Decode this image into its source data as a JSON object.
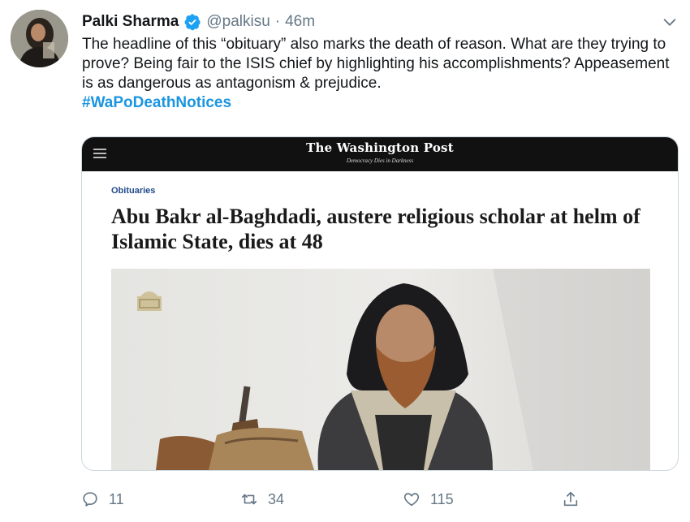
{
  "tweet": {
    "author_name": "Palki Sharma",
    "handle": "@palkisu",
    "separator": "·",
    "time": "46m",
    "text": "The headline of this “obituary” also marks the death of reason. What are they trying to prove? Being fair to the ISIS chief by highlighting his accomplishments? Appeasement is as dangerous as antagonism & prejudice.",
    "hashtag": "#WaPoDeathNotices",
    "icons": {
      "verified": "verified-badge-icon",
      "more": "chevron-down-icon"
    },
    "accent_color": "#1b95e0"
  },
  "card": {
    "masthead": "The Washington Post",
    "tagline": "Democracy Dies in Darkness",
    "section": "Obituaries",
    "headline": "Abu Bakr al-Baghdadi, austere religious scholar at helm of Islamic State, dies at 48",
    "icons": {
      "menu": "hamburger-menu-icon"
    }
  },
  "actions": {
    "replies": "11",
    "retweets": "34",
    "likes": "115",
    "icons": {
      "reply": "reply-icon",
      "retweet": "retweet-icon",
      "like": "heart-icon",
      "share": "share-icon"
    }
  }
}
